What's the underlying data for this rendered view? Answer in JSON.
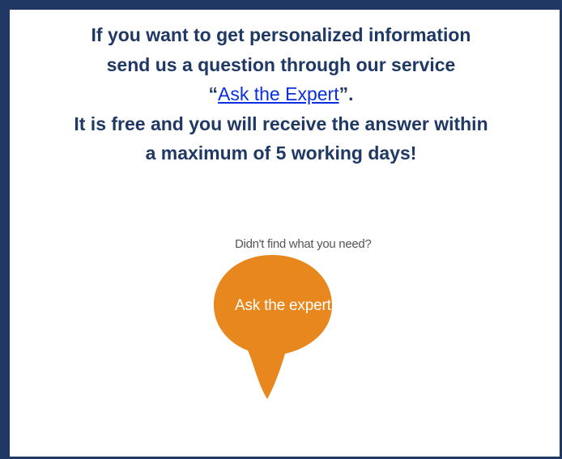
{
  "intro": {
    "line1": "If you want to get personalized information",
    "line2": "send us a question through our service",
    "open_quote": "“",
    "link_text": "Ask the Expert",
    "close_quote": "”.",
    "line4": "It is free and you will receive the answer within",
    "line5": "a maximum of 5 working days!"
  },
  "promo": {
    "caption": "Didn't find what you need?",
    "bubble_label": "Ask the expert",
    "bubble_color": "#e8871e"
  },
  "colors": {
    "border": "#1f3864",
    "heading": "#1f3864",
    "link": "#0b2ee0"
  }
}
